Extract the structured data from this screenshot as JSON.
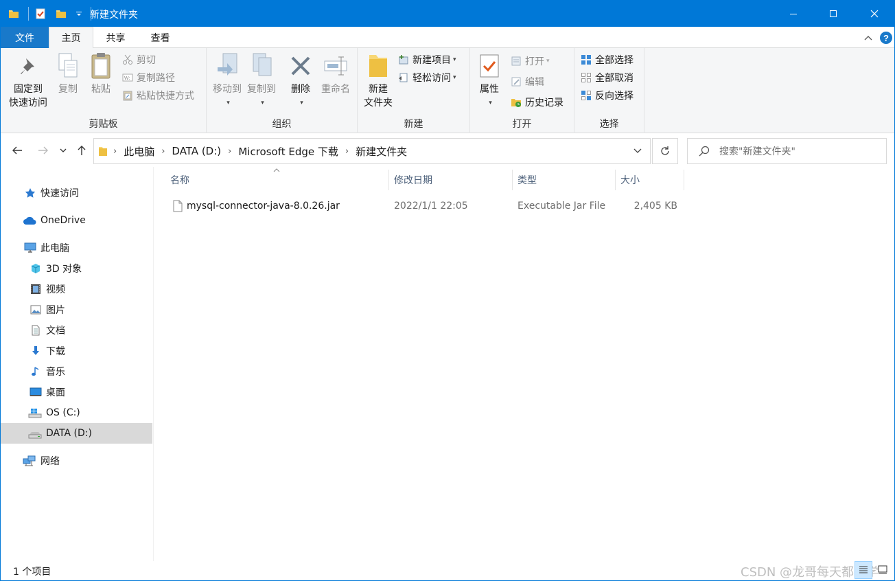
{
  "window": {
    "title": "新建文件夹",
    "accent": "#0078d7"
  },
  "ribbon_tabs": [
    "文件",
    "主页",
    "共享",
    "查看"
  ],
  "ribbon": {
    "clipboard": {
      "label": "剪贴板",
      "pin_line1": "固定到",
      "pin_line2": "快速访问",
      "copy": "复制",
      "paste": "粘贴",
      "cut": "剪切",
      "copy_path": "复制路径",
      "paste_shortcut": "粘贴快捷方式"
    },
    "organize": {
      "label": "组织",
      "move_to": "移动到",
      "copy_to": "复制到",
      "delete": "删除",
      "rename": "重命名"
    },
    "new": {
      "label": "新建",
      "new_folder_line1": "新建",
      "new_folder_line2": "文件夹",
      "new_item": "新建项目",
      "easy_access": "轻松访问"
    },
    "open": {
      "label": "打开",
      "properties": "属性",
      "open": "打开",
      "edit": "编辑",
      "history": "历史记录"
    },
    "select": {
      "label": "选择",
      "select_all": "全部选择",
      "select_none": "全部取消",
      "invert": "反向选择"
    }
  },
  "address": {
    "breadcrumbs": [
      "此电脑",
      "DATA (D:)",
      "Microsoft Edge 下载",
      "新建文件夹"
    ],
    "search_placeholder": "搜索\"新建文件夹\""
  },
  "sidebar": {
    "items": [
      {
        "label": "快速访问",
        "icon": "star-icon"
      },
      {
        "label": "OneDrive",
        "icon": "cloud-icon"
      },
      {
        "label": "此电脑",
        "icon": "computer-icon"
      },
      {
        "label": "3D 对象",
        "icon": "cube-icon"
      },
      {
        "label": "视频",
        "icon": "film-icon"
      },
      {
        "label": "图片",
        "icon": "picture-icon"
      },
      {
        "label": "文档",
        "icon": "document-icon"
      },
      {
        "label": "下载",
        "icon": "download-icon"
      },
      {
        "label": "音乐",
        "icon": "music-icon"
      },
      {
        "label": "桌面",
        "icon": "desktop-icon"
      },
      {
        "label": "OS (C:)",
        "icon": "windows-drive-icon"
      },
      {
        "label": "DATA (D:)",
        "icon": "drive-icon"
      },
      {
        "label": "网络",
        "icon": "network-icon"
      }
    ],
    "selected": "DATA (D:)"
  },
  "columns": [
    "名称",
    "修改日期",
    "类型",
    "大小"
  ],
  "files": [
    {
      "name": "mysql-connector-java-8.0.26.jar",
      "modified": "2022/1/1 22:05",
      "type": "Executable Jar File",
      "size": "2,405 KB"
    }
  ],
  "status": {
    "count": "1 个项目",
    "watermark": "CSDN @龙哥每天都要学"
  }
}
